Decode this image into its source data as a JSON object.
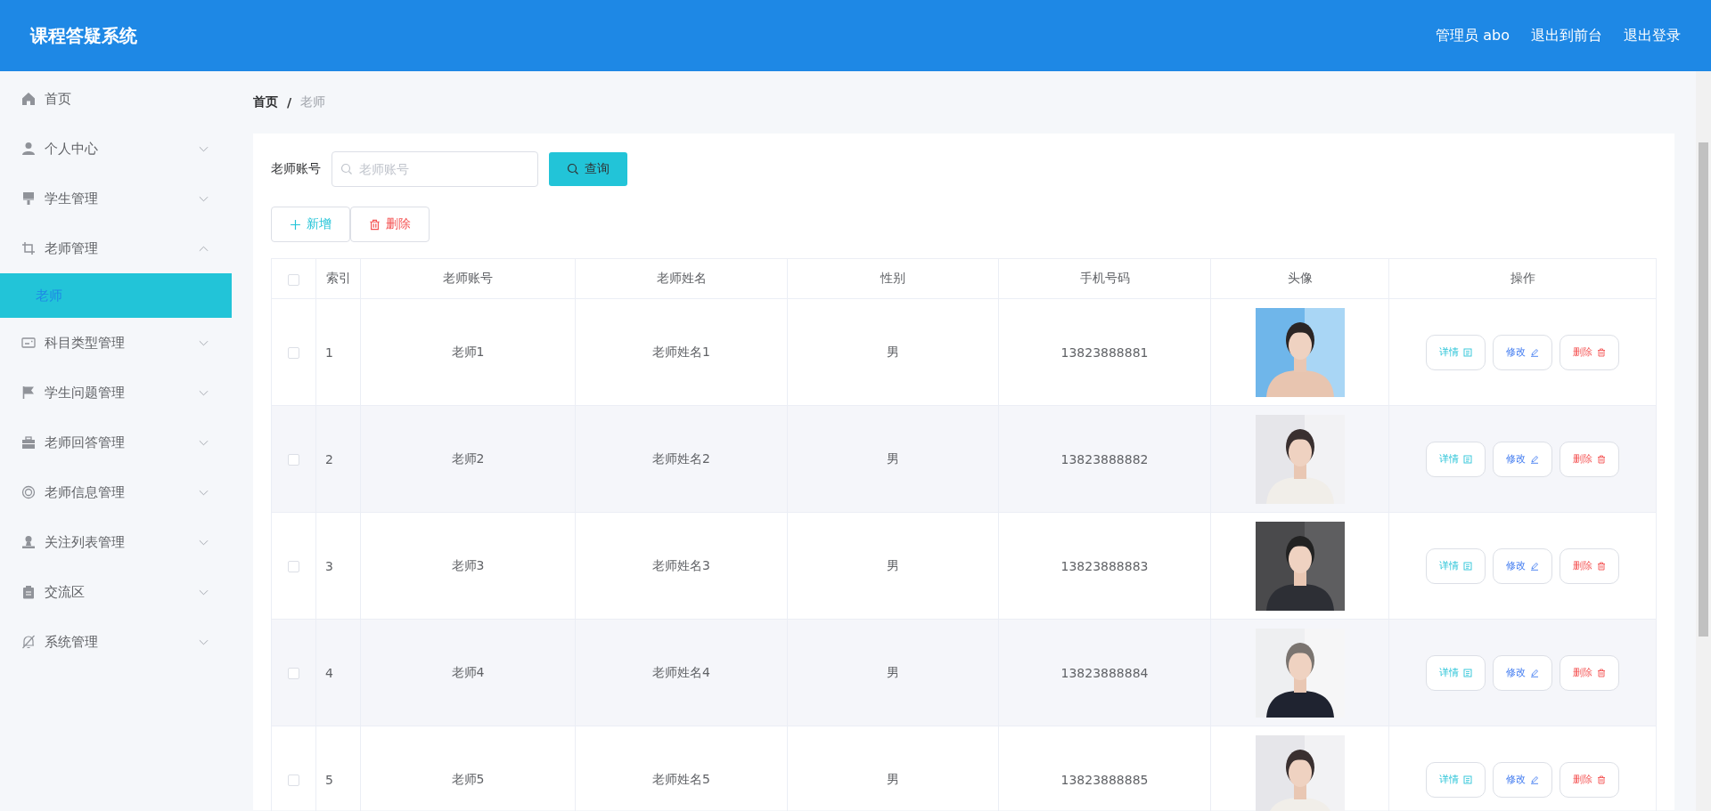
{
  "header": {
    "title": "课程答疑系统",
    "user_label": "管理员 abo",
    "links": [
      "退出到前台",
      "退出登录"
    ]
  },
  "sidebar": {
    "items": [
      {
        "label": "首页",
        "kind": "home"
      },
      {
        "label": "个人中心",
        "kind": "user",
        "expanded": false
      },
      {
        "label": "学生管理",
        "kind": "brush",
        "expanded": false
      },
      {
        "label": "老师管理",
        "kind": "crop",
        "expanded": true,
        "children": [
          {
            "label": "老师",
            "selected": true
          }
        ]
      },
      {
        "label": "科目类型管理",
        "kind": "card",
        "expanded": false
      },
      {
        "label": "学生问题管理",
        "kind": "flag",
        "expanded": false
      },
      {
        "label": "老师回答管理",
        "kind": "case",
        "expanded": false
      },
      {
        "label": "老师信息管理",
        "kind": "ring",
        "expanded": false
      },
      {
        "label": "关注列表管理",
        "kind": "stamp",
        "expanded": false
      },
      {
        "label": "交流区",
        "kind": "clipboard",
        "expanded": false
      },
      {
        "label": "系统管理",
        "kind": "bell",
        "expanded": false
      }
    ]
  },
  "breadcrumb": {
    "items": [
      "首页",
      "老师"
    ],
    "separator": "/"
  },
  "search": {
    "label": "老师账号",
    "placeholder": "老师账号",
    "button": "查询"
  },
  "actions": [
    {
      "label": "新增",
      "kind": "add"
    },
    {
      "label": "删除",
      "kind": "delete"
    }
  ],
  "table": {
    "select_all": {
      "checked": false
    },
    "columns": [
      "索引",
      "老师账号",
      "老师姓名",
      "性别",
      "手机号码",
      "头像",
      "操作"
    ],
    "rows": [
      {
        "checked": false,
        "index": "1",
        "account": "老师1",
        "name": "老师姓名1",
        "gender": "男",
        "phone": "13823888881",
        "actions": [
          {
            "label": "详情",
            "kind": "detail"
          },
          {
            "label": "修改",
            "kind": "edit"
          },
          {
            "label": "删除",
            "kind": "delete"
          }
        ]
      },
      {
        "checked": false,
        "index": "2",
        "account": "老师2",
        "name": "老师姓名2",
        "gender": "男",
        "phone": "13823888882",
        "actions": [
          {
            "label": "详情",
            "kind": "detail"
          },
          {
            "label": "修改",
            "kind": "edit"
          },
          {
            "label": "删除",
            "kind": "delete"
          }
        ]
      },
      {
        "checked": false,
        "index": "3",
        "account": "老师3",
        "name": "老师姓名3",
        "gender": "男",
        "phone": "13823888883",
        "actions": [
          {
            "label": "详情",
            "kind": "detail"
          },
          {
            "label": "修改",
            "kind": "edit"
          },
          {
            "label": "删除",
            "kind": "delete"
          }
        ]
      },
      {
        "checked": false,
        "index": "4",
        "account": "老师4",
        "name": "老师姓名4",
        "gender": "男",
        "phone": "13823888884",
        "actions": [
          {
            "label": "详情",
            "kind": "detail"
          },
          {
            "label": "修改",
            "kind": "edit"
          },
          {
            "label": "删除",
            "kind": "delete"
          }
        ]
      },
      {
        "checked": false,
        "index": "5",
        "account": "老师5",
        "name": "老师姓名5",
        "gender": "男",
        "phone": "13823888885",
        "actions": [
          {
            "label": "详情",
            "kind": "detail"
          },
          {
            "label": "修改",
            "kind": "edit"
          },
          {
            "label": "删除",
            "kind": "delete"
          }
        ]
      }
    ]
  }
}
